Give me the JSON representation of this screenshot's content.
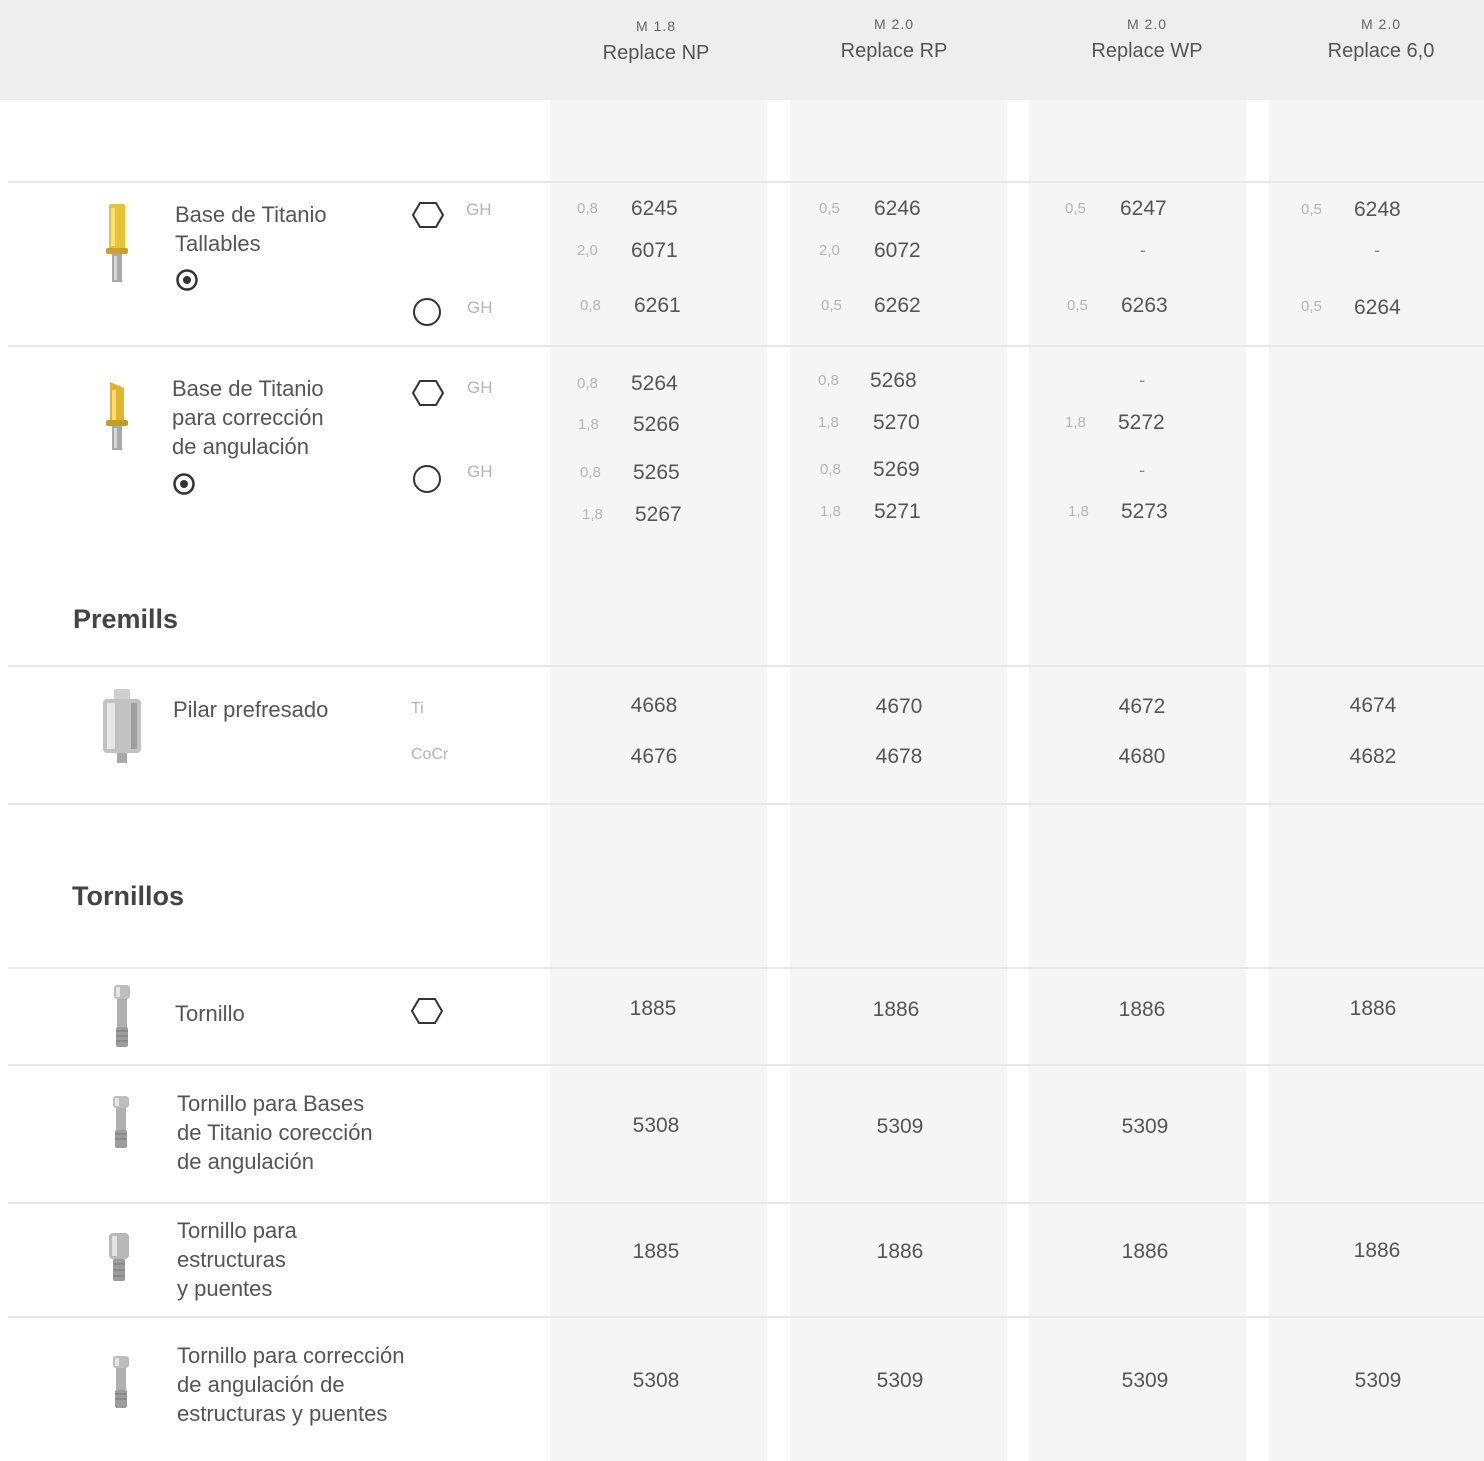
{
  "columns": [
    {
      "model": "M 1.8",
      "name": "Replace NP"
    },
    {
      "model": "M 2.0",
      "name": "Replace RP"
    },
    {
      "model": "M 2.0",
      "name": "Replace WP"
    },
    {
      "model": "M 2.0",
      "name": "Replace 6,0"
    }
  ],
  "sections": {
    "premills": "Premills",
    "tornillos": "Tornillos"
  },
  "rows": {
    "tallables": {
      "label": [
        "Base de Titanio",
        "Tallables"
      ],
      "gh_hex": "GH",
      "gh_round": "GH",
      "np": {
        "h1": "0,8",
        "c1": "6245",
        "h2": "2,0",
        "c2": "6071",
        "h3": "0,8",
        "c3": "6261"
      },
      "rp": {
        "h1": "0,5",
        "c1": "6246",
        "h2": "2,0",
        "c2": "6072",
        "h3": "0,5",
        "c3": "6262"
      },
      "wp": {
        "h1": "0,5",
        "c1": "6247",
        "dash": "-",
        "h3": "0,5",
        "c3": "6263"
      },
      "six": {
        "h1": "0,5",
        "c1": "6248",
        "dash": "-",
        "h3": "0,5",
        "c3": "6264"
      }
    },
    "angulacion": {
      "label": [
        "Base de Titanio",
        "para corrección",
        "de angulación"
      ],
      "gh_hex": "GH",
      "gh_round": "GH",
      "np": {
        "h1": "0,8",
        "c1": "5264",
        "h2": "1,8",
        "c2": "5266",
        "h3": "0,8",
        "c3": "5265",
        "h4": "1,8",
        "c4": "5267"
      },
      "rp": {
        "h1": "0,8",
        "c1": "5268",
        "h2": "1,8",
        "c2": "5270",
        "h3": "0,8",
        "c3": "5269",
        "h4": "1,8",
        "c4": "5271"
      },
      "wp": {
        "dash1": "-",
        "h2": "1,8",
        "c2": "5272",
        "dash3": "-",
        "h4": "1,8",
        "c4": "5273"
      }
    },
    "prefresado": {
      "label": "Pilar prefresado",
      "mat1": "Ti",
      "mat2": "CoCr",
      "codes1": [
        "4668",
        "4670",
        "4672",
        "4674"
      ],
      "codes2": [
        "4676",
        "4678",
        "4680",
        "4682"
      ]
    },
    "tornillo": {
      "label": "Tornillo",
      "codes": [
        "1885",
        "1886",
        "1886",
        "1886"
      ]
    },
    "tornillo_bases": {
      "label": [
        "Tornillo para Bases",
        "de Titanio corección",
        "de angulación"
      ],
      "codes": [
        "5308",
        "5309",
        "5309"
      ]
    },
    "tornillo_estructuras": {
      "label": [
        "Tornillo para",
        "estructuras",
        "y puentes"
      ],
      "codes": [
        "1885",
        "1886",
        "1886",
        "1886"
      ]
    },
    "tornillo_correccion": {
      "label": [
        "Tornillo para corrección",
        "de angulación de",
        "estructuras y puentes"
      ],
      "codes": [
        "5308",
        "5309",
        "5309",
        "5309"
      ]
    }
  }
}
